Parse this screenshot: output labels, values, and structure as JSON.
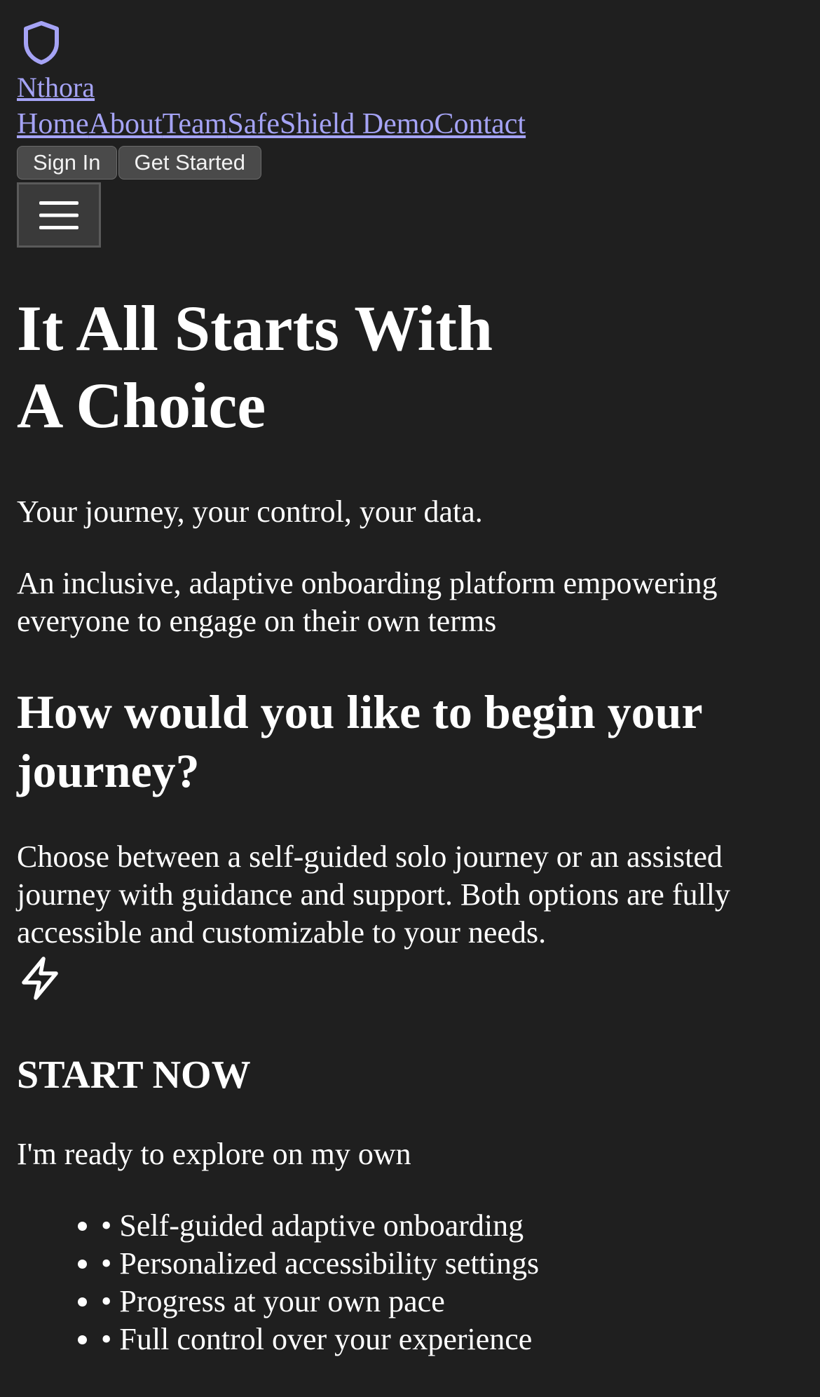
{
  "brand": {
    "name": "Nthora",
    "logo_icon": "shield-icon",
    "accent_color": "#a5a3f5"
  },
  "nav": {
    "items": [
      {
        "label": "Home"
      },
      {
        "label": "About"
      },
      {
        "label": "Team"
      },
      {
        "label": "SafeShield Demo"
      },
      {
        "label": "Contact"
      }
    ]
  },
  "auth": {
    "sign_in_label": "Sign In",
    "get_started_label": "Get Started"
  },
  "menu": {
    "icon": "hamburger-menu-icon"
  },
  "hero": {
    "title_line1": "It All Starts With",
    "title_line2": "A Choice",
    "tagline": "Your journey, your control, your data.",
    "description": "An inclusive, adaptive onboarding platform empowering everyone to engage on their own terms"
  },
  "journey": {
    "title": "How would you like to begin your journey?",
    "text": "Choose between a self-guided solo journey or an assisted journey with guidance and support. Both options are fully accessible and customizable to your needs."
  },
  "option": {
    "icon": "lightning-bolt-icon",
    "title": "START NOW",
    "subtitle": "I'm ready to explore on my own",
    "features": [
      "• Self-guided adaptive onboarding",
      "• Personalized accessibility settings",
      "• Progress at your own pace",
      "• Full control over your experience"
    ]
  },
  "colors": {
    "background": "#1f1f1f",
    "text": "#ffffff",
    "link": "#a5a3f5",
    "button_bg": "#4a4a4a"
  }
}
